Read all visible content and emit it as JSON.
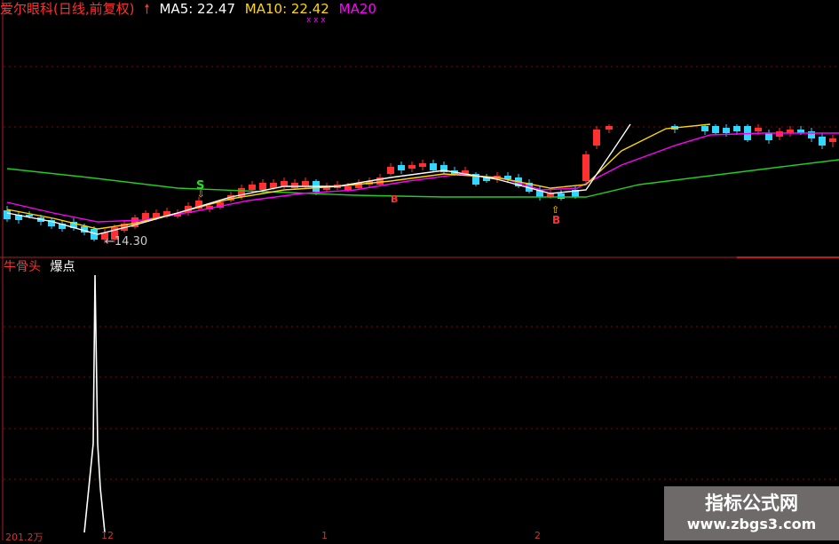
{
  "header": {
    "stock": "爱尔眼科(日线,前复权)",
    "ma5": "MA5: 22.47",
    "ma10": "MA10: 22.42",
    "ma20": "MA20",
    "marks": "x x x"
  },
  "main_panel": {
    "signal_s": "S",
    "signal_b1": "B",
    "signal_b2": "B",
    "low_label": "←14.30"
  },
  "indicator_panel": {
    "name": "牛骨头",
    "line_name": "爆点"
  },
  "bottom_axis": {
    "left_value": "201.2万",
    "tick_12": "12",
    "tick_1": "1",
    "tick_2": "2"
  },
  "watermark": {
    "title": "指标公式网",
    "url": "www.zbgs3.com"
  },
  "colors": {
    "background": "#000000",
    "up": "#ff3030",
    "down": "#30d8ff",
    "ma5": "#ffffff",
    "ma10": "#ffd700",
    "ma20": "#ff00ff",
    "ma60": "#22cc22",
    "gridline": "#8b0000"
  }
}
